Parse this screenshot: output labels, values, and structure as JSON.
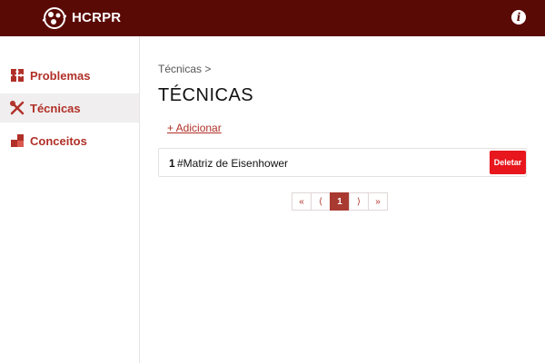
{
  "header": {
    "brand": "HCRPR",
    "info_icon": "info-icon"
  },
  "sidebar": {
    "items": [
      {
        "label": "Problemas",
        "icon": "puzzle-icon",
        "active": false
      },
      {
        "label": "Técnicas",
        "icon": "tools-icon",
        "active": true
      },
      {
        "label": "Conceitos",
        "icon": "blocks-icon",
        "active": false
      }
    ]
  },
  "main": {
    "breadcrumb": "Técnicas >",
    "title": "TÉCNICAS",
    "add_link": "+ Adicionar",
    "items": [
      {
        "number": "1",
        "name": "#Matriz de Eisenhower",
        "delete_label": "Deletar"
      }
    ],
    "pagination": {
      "first": "«",
      "prev": "⟨",
      "current": "1",
      "next": "⟩",
      "last": "»"
    }
  },
  "colors": {
    "topbar": "#5a0a05",
    "accent": "#b03028",
    "delete": "#e8161d"
  }
}
